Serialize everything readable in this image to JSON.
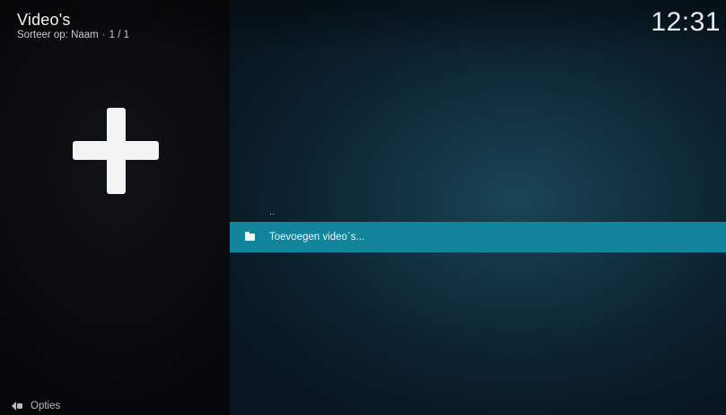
{
  "header": {
    "title": "Video's",
    "sort_label": "Sorteer op: Naam",
    "sort_separator": "·",
    "page_indicator": "1 / 1",
    "clock": "12:31"
  },
  "sidebar": {
    "icon": "plus-icon"
  },
  "list": {
    "items": [
      {
        "label": "..",
        "icon": ""
      },
      {
        "label": "Toevoegen video`s...",
        "icon": "folder-icon",
        "selected": true
      }
    ]
  },
  "footer": {
    "options_label": "Opties",
    "options_icon": "options-icon"
  },
  "colors": {
    "selection": "#12849c",
    "text": "#f2f2f2"
  }
}
